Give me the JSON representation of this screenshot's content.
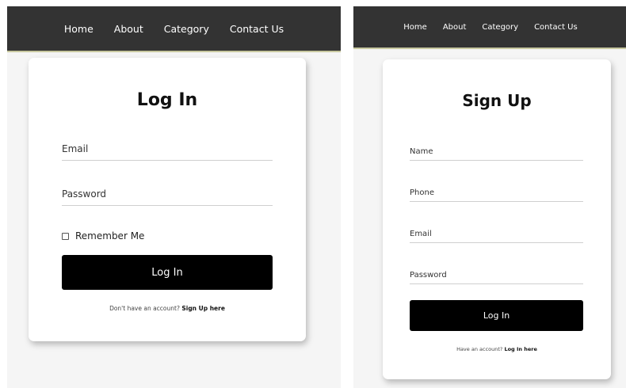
{
  "nav": {
    "items": [
      "Home",
      "About",
      "Category",
      "Contact Us"
    ]
  },
  "login": {
    "title": "Log In",
    "email_placeholder": "Email",
    "password_placeholder": "Password",
    "remember_label": "Remember Me",
    "submit_label": "Log In",
    "footer_text": "Don't have an account?",
    "footer_link": "Sign Up here"
  },
  "signup": {
    "title": "Sign Up",
    "name_placeholder": "Name",
    "phone_placeholder": "Phone",
    "email_placeholder": "Email",
    "password_placeholder": "Password",
    "submit_label": "Log In",
    "footer_text": "Have an account?",
    "footer_link": "Log In here"
  },
  "colors": {
    "navbar": "#333333",
    "button": "#000000",
    "background": "#f5f5f5"
  }
}
